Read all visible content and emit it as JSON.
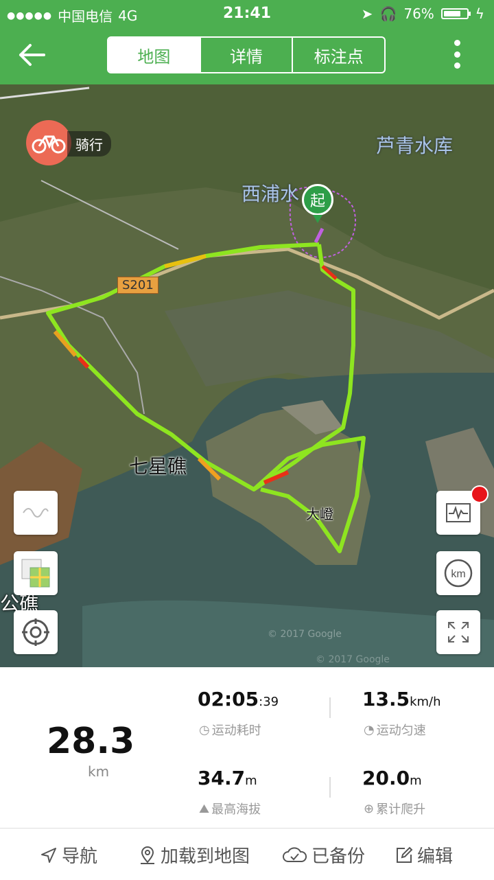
{
  "status": {
    "carrier": "中国电信",
    "network": "4G",
    "time": "21:41",
    "battery": "76%",
    "battery_level": 0.76
  },
  "tabs": [
    {
      "label": "地图",
      "active": true
    },
    {
      "label": "详情",
      "active": false
    },
    {
      "label": "标注点",
      "active": false
    }
  ],
  "map": {
    "ride_label": "骑行",
    "start_label": "起",
    "places": [
      "芦青水库",
      "西浦水",
      "七星礁",
      "大嶝",
      "公礁"
    ],
    "road_sign": "S201",
    "watermarks": [
      "© 2017 Google",
      "© 2017 Google"
    ]
  },
  "stats": {
    "distance": "28.3",
    "distance_unit": "km",
    "duration": "02:05",
    "duration_seconds": ":39",
    "duration_label": "运动耗时",
    "speed": "13.5",
    "speed_unit": "km/h",
    "speed_label": "运动匀速",
    "max_altitude": "34.7",
    "max_altitude_unit": "m",
    "max_altitude_label": "最高海拔",
    "climb": "20.0",
    "climb_unit": "m",
    "climb_label": "累计爬升"
  },
  "bottom": [
    "导航",
    "加载到地图",
    "已备份",
    "编辑"
  ],
  "colors": {
    "brand": "#4caf50",
    "ride_badge": "#ec6a55",
    "track_fast": "#88ee22",
    "track_slow": "#e83018"
  }
}
